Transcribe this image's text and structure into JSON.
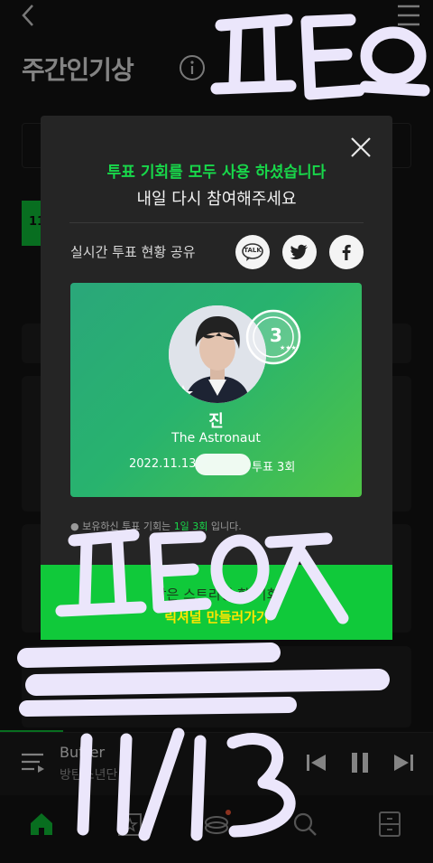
{
  "page": {
    "title": "주간인기상",
    "tab_number": "11"
  },
  "modal": {
    "message_line1": "투표 기회를 모두 사용 하셨습니다",
    "message_line2": "내일 다시 참여해주세요",
    "share_label": "실시간 투표 현황 공유",
    "talk_label": "TALK",
    "card": {
      "artist": "진",
      "song": "The Astronaut",
      "date": "2022.11.13",
      "vote_count_label": "투표 3회",
      "rank_badge": "3"
    },
    "note_prefix": "보유하신 투표 기회는",
    "note_highlight": "1일 3회",
    "note_suffix": "입니다.",
    "cta_line1": "남은 스트리밍 할 기회",
    "cta_line2": "릭셔널 만들러가기"
  },
  "player": {
    "track": "Butter",
    "artist": "방탄소년단"
  },
  "annotations": {
    "top": "ㅍEㅇ",
    "middle": "ㅍEㅇㅈ",
    "bottom": "11/13"
  },
  "colors": {
    "accent_green": "#10c93a",
    "highlight_yellow": "#ffe600",
    "scribble": "#ebe6fb"
  }
}
